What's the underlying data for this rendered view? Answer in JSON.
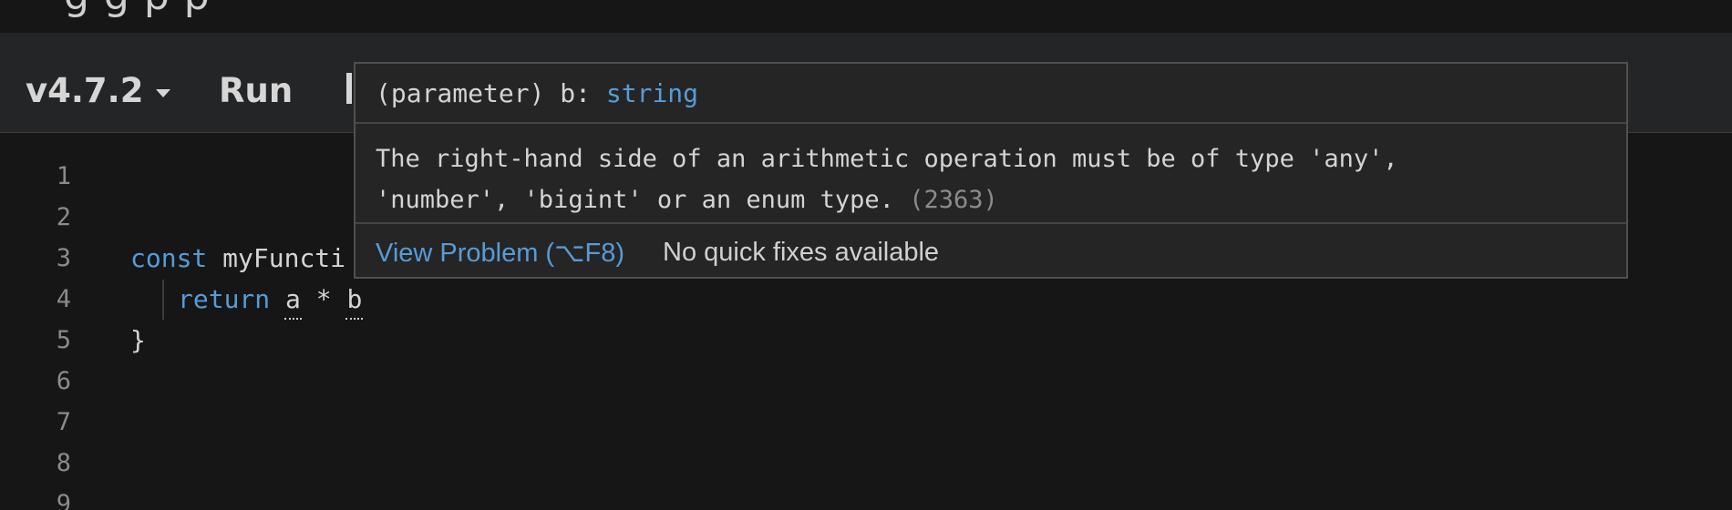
{
  "header": {
    "title_fragment": "g           g      p               p"
  },
  "toolbar": {
    "version_label": "v4.7.2",
    "run_label": "Run"
  },
  "editor": {
    "line_numbers": [
      "1",
      "2",
      "3",
      "4",
      "5",
      "6",
      "7",
      "8",
      "9"
    ],
    "line3": {
      "keyword": "const",
      "rest": " myFuncti"
    },
    "line4": {
      "keyword": "return",
      "operand_a": "a",
      "operator": " * ",
      "operand_b": "b"
    },
    "line5": {
      "text": "}"
    }
  },
  "tooltip": {
    "signature_prefix": "(parameter) b: ",
    "signature_type": "string",
    "message_line1": "The right-hand side of an arithmetic operation must be of type 'any',",
    "message_line2": "'number', 'bigint' or an enum type.",
    "error_code": "(2363)",
    "view_problem_label": "View Problem (⌥F8)",
    "no_fixes_label": "No quick fixes available"
  },
  "colors": {
    "background": "#161617",
    "toolbar": "#242526",
    "keyword": "#569cd6",
    "tooltip_bg": "#252526",
    "link": "#569cd6"
  }
}
